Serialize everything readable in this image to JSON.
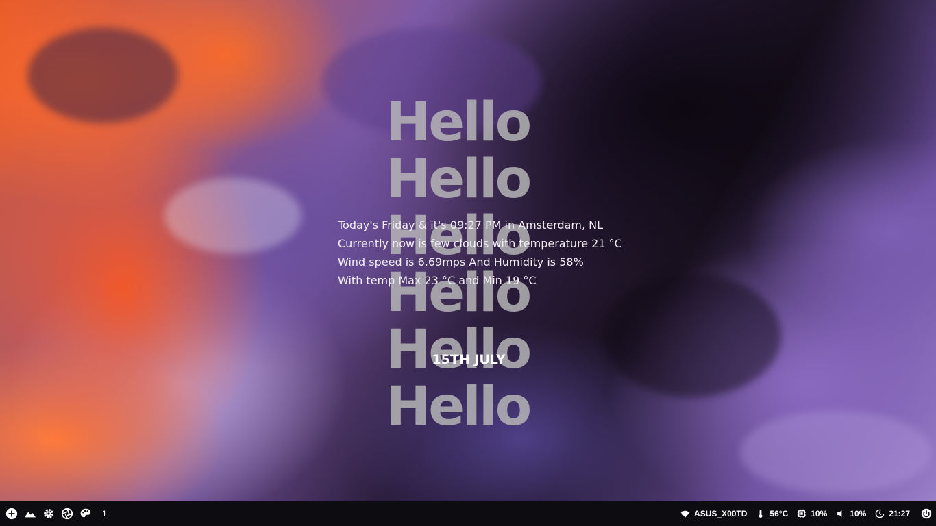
{
  "desktop": {
    "hello_lines": [
      "Hello",
      "Hello",
      "Hello",
      "Hello",
      "Hello",
      "Hello"
    ],
    "weather_lines": [
      "Today's Friday & it's 09:27 PM in Amsterdam, NL",
      "Currently now is few clouds with temperature 21 °C",
      "Wind speed is 6.69mps And Humidity is 58%",
      "With temp Max 23 °C and Min 19 °C"
    ],
    "date": "15TH JULY"
  },
  "taskbar": {
    "left_icons": [
      "add-icon",
      "mountain-icon",
      "gear-icon",
      "aperture-icon",
      "palette-icon"
    ],
    "workspace": "1",
    "wifi": {
      "icon": "wifi-icon",
      "label": "ASUS_X00TD"
    },
    "temperature": {
      "icon": "thermometer-icon",
      "label": "56°C"
    },
    "cpu": {
      "icon": "cpu-icon",
      "label": "10%"
    },
    "volume": {
      "icon": "volume-icon",
      "label": "10%"
    },
    "clock": {
      "icon": "clock-icon",
      "label": "21:27"
    },
    "power": {
      "icon": "power-icon"
    }
  }
}
